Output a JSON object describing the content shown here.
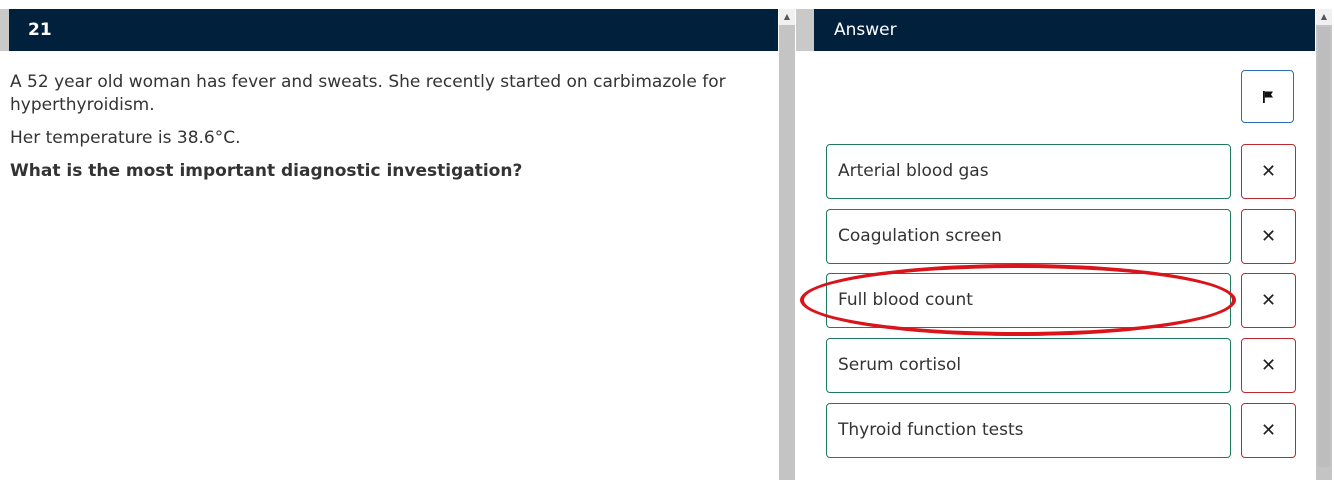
{
  "question": {
    "number": "21",
    "paragraphs": [
      "A 52 year old woman has fever and sweats. She recently started on carbimazole for hyperthyroidism.",
      "Her temperature is 38.6°C."
    ],
    "prompt": "What is the most important diagnostic investigation?"
  },
  "answer": {
    "title": "Answer",
    "flag_icon": "flag-icon",
    "options": [
      {
        "label": "Arterial blood gas",
        "remove": "✕"
      },
      {
        "label": "Coagulation screen",
        "remove": "✕"
      },
      {
        "label": "Full blood count",
        "remove": "✕"
      },
      {
        "label": "Serum cortisol",
        "remove": "✕"
      },
      {
        "label": "Thyroid function tests",
        "remove": "✕"
      }
    ]
  },
  "scrollbar": {
    "up_arrow": "▲"
  },
  "colors": {
    "header": "#00203b",
    "option_border": "#1e7a5e",
    "remove_border": "#c0282f",
    "flag_border": "#2a6fb0",
    "annotation_circle": "#d9141b"
  }
}
